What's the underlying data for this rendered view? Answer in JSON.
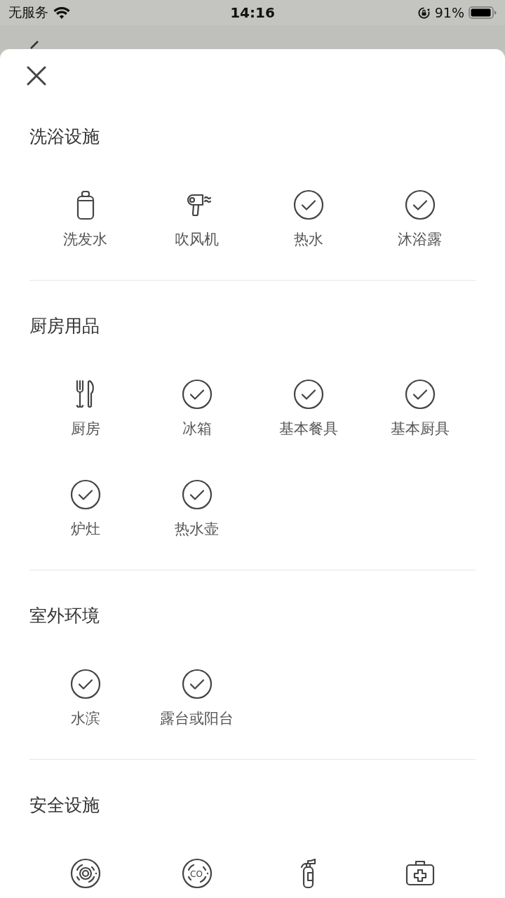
{
  "status_bar": {
    "carrier": "无服务",
    "time": "14:16",
    "battery": "91%"
  },
  "sections": [
    {
      "title": "洗浴设施",
      "items": [
        {
          "kind": "bottle",
          "label": "洗发水"
        },
        {
          "kind": "hairdryer",
          "label": "吹风机"
        },
        {
          "kind": "check",
          "label": "热水"
        },
        {
          "kind": "check",
          "label": "沐浴露"
        }
      ]
    },
    {
      "title": "厨房用品",
      "items": [
        {
          "kind": "utensils",
          "label": "厨房"
        },
        {
          "kind": "check",
          "label": "冰箱"
        },
        {
          "kind": "check",
          "label": "基本餐具"
        },
        {
          "kind": "check",
          "label": "基本厨具"
        },
        {
          "kind": "check",
          "label": "炉灶"
        },
        {
          "kind": "check",
          "label": "热水壶"
        }
      ]
    },
    {
      "title": "室外环境",
      "items": [
        {
          "kind": "check",
          "label": "水滨"
        },
        {
          "kind": "check",
          "label": "露台或阳台"
        }
      ]
    },
    {
      "title": "安全设施",
      "items": [
        {
          "kind": "smoke"
        },
        {
          "kind": "gas",
          "icon_text": "CO"
        },
        {
          "kind": "extinguisher"
        },
        {
          "kind": "firstaid"
        }
      ]
    }
  ]
}
